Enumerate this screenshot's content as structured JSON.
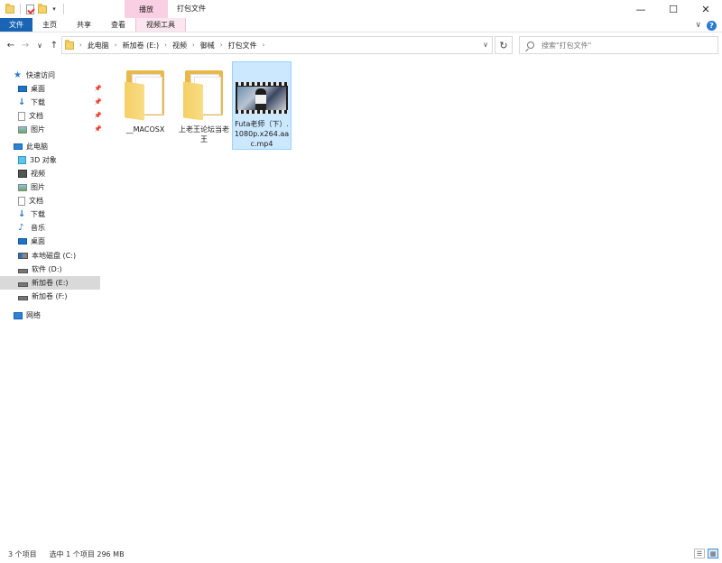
{
  "window": {
    "title": "打包文件",
    "context_tab_header": "播放",
    "controls": {
      "minimize": "—",
      "maximize": "☐",
      "close": "✕"
    }
  },
  "ribbon": {
    "tabs": [
      "文件",
      "主页",
      "共享",
      "查看",
      "视频工具"
    ],
    "file_tab_color": "#1a64b4",
    "context_tab_color": "#f9d0e3"
  },
  "address": {
    "crumbs": [
      "此电脑",
      "新加卷 (E:)",
      "视频",
      "御械",
      "打包文件"
    ]
  },
  "search": {
    "placeholder": "搜索\"打包文件\""
  },
  "sidebar": {
    "quick_access": {
      "label": "快速访问",
      "items": [
        {
          "label": "桌面",
          "icon": "desktop-icon",
          "pinned": true
        },
        {
          "label": "下载",
          "icon": "download-icon",
          "pinned": true
        },
        {
          "label": "文档",
          "icon": "document-icon",
          "pinned": true
        },
        {
          "label": "图片",
          "icon": "pictures-icon",
          "pinned": true
        }
      ]
    },
    "this_pc": {
      "label": "此电脑",
      "items": [
        {
          "label": "3D 对象",
          "icon": "3d-objects-icon"
        },
        {
          "label": "视频",
          "icon": "videos-icon"
        },
        {
          "label": "图片",
          "icon": "pictures-icon"
        },
        {
          "label": "文档",
          "icon": "document-icon"
        },
        {
          "label": "下载",
          "icon": "download-icon"
        },
        {
          "label": "音乐",
          "icon": "music-icon"
        },
        {
          "label": "桌面",
          "icon": "desktop-icon"
        },
        {
          "label": "本地磁盘 (C:)",
          "icon": "windows-drive-icon"
        },
        {
          "label": "软件 (D:)",
          "icon": "drive-icon"
        },
        {
          "label": "新加卷 (E:)",
          "icon": "drive-icon",
          "selected": true
        },
        {
          "label": "新加卷 (F:)",
          "icon": "drive-icon"
        }
      ]
    },
    "network": {
      "label": "网络"
    }
  },
  "files": [
    {
      "name": "__MACOSX",
      "type": "folder"
    },
    {
      "name": "上老王论坛当老王",
      "type": "folder"
    },
    {
      "name": "Futa老师（下）.1080p.x264.aac.mp4",
      "type": "video",
      "selected": true
    }
  ],
  "status": {
    "item_count": "3 个项目",
    "selection": "选中 1 个项目  296 MB"
  },
  "colors": {
    "selection_bg": "#cce8ff",
    "selection_border": "#99d1ff",
    "accent": "#1a64b4"
  }
}
